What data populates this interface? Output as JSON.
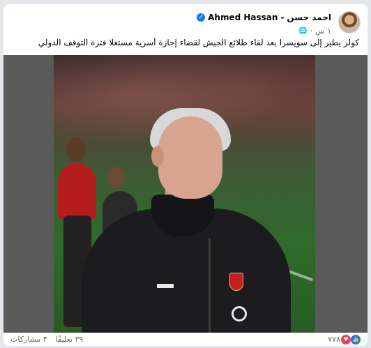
{
  "post": {
    "author_ar": "احمد حسن",
    "separator": "-",
    "author_en": "Ahmed Hassan",
    "verified_icon": "verified-check-icon",
    "time": "١ س",
    "audience_icon": "globe-icon",
    "caption": "كولر يطير إلى سويسرا بعد لقاء طلائع الجيش لقضاء إجازة أسرية مستغلا فترة التوقف الدولي"
  },
  "footer": {
    "reaction_count": "٧٧٨",
    "comments": "٣٩ تعليقًا",
    "shares": "٣ مشاركات"
  },
  "colors": {
    "accent": "#1877f2",
    "love": "#f33e58",
    "text_secondary": "#65676b",
    "background": "#e4e6eb"
  }
}
